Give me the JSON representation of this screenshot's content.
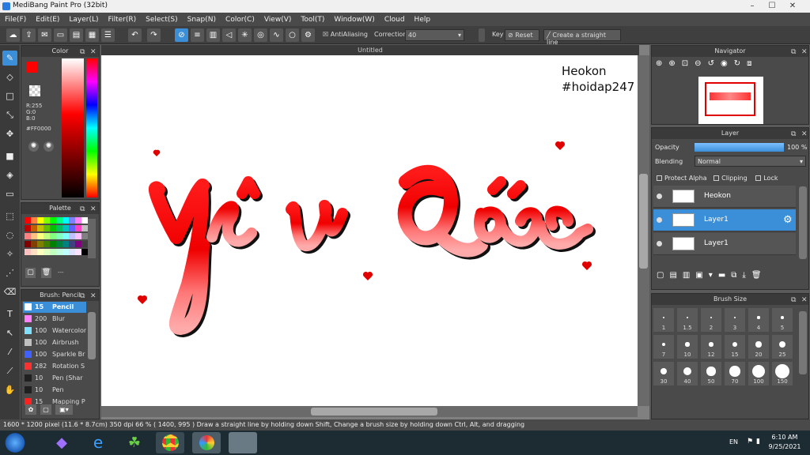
{
  "window": {
    "title": "MediBang Paint Pro (32bit)"
  },
  "menu": [
    "File(F)",
    "Edit(E)",
    "Layer(L)",
    "Filter(R)",
    "Select(S)",
    "Snap(N)",
    "Color(C)",
    "View(V)",
    "Tool(T)",
    "Window(W)",
    "Cloud",
    "Help"
  ],
  "toolbar": {
    "antialias_label": "AntiAliasing",
    "correction_label": "Correction",
    "correction_value": "40",
    "key_label": "Key",
    "reset_label": "Reset",
    "straight_line_label": "Create a straight line"
  },
  "color_panel": {
    "title": "Color",
    "r": "R:255",
    "g": "G:0",
    "b": "B:0",
    "hex": "#FF0000",
    "primary": "#ff0000",
    "secondary": "#ff8c00"
  },
  "palette_panel": {
    "title": "Palette",
    "colors": [
      "#ff0000",
      "#ff8040",
      "#ffff00",
      "#80ff00",
      "#00ff00",
      "#00ff80",
      "#00ffff",
      "#8080ff",
      "#ff80ff",
      "#ffffff",
      "#c00000",
      "#c06000",
      "#c0c000",
      "#60c000",
      "#00c000",
      "#00c060",
      "#00c0c0",
      "#6060ff",
      "#ff40c0",
      "#c0c0c0",
      "#ff8080",
      "#ffc080",
      "#ffff80",
      "#c0ff80",
      "#80ff80",
      "#80ffc0",
      "#80ffff",
      "#c0c0ff",
      "#ffc0ff",
      "#808080",
      "#800000",
      "#804000",
      "#808000",
      "#408000",
      "#008000",
      "#008040",
      "#008080",
      "#404080",
      "#800080",
      "#404040",
      "#ffc0c0",
      "#ffe0c0",
      "#ffffc0",
      "#e0ffc0",
      "#c0ffc0",
      "#c0ffe0",
      "#c0ffff",
      "#e0e0ff",
      "#ffe0ff",
      "#000000"
    ],
    "extra": "---"
  },
  "brush_panel": {
    "title": "Brush: Pencil",
    "items": [
      {
        "size": "15",
        "name": "Pencil",
        "color": "#ffffff",
        "selected": true
      },
      {
        "size": "200",
        "name": "Blur",
        "color": "#ff80ff",
        "selected": false
      },
      {
        "size": "100",
        "name": "Watercolor",
        "color": "#80e0ff",
        "selected": false
      },
      {
        "size": "100",
        "name": "Airbrush",
        "color": "#c0c0c0",
        "selected": false
      },
      {
        "size": "100",
        "name": "Sparkle Br",
        "color": "#4060ff",
        "selected": false
      },
      {
        "size": "282",
        "name": "Rotation S",
        "color": "#ff3030",
        "selected": false
      },
      {
        "size": "10",
        "name": "Pen (Shar",
        "color": "#202020",
        "selected": false
      },
      {
        "size": "10",
        "name": "Pen",
        "color": "#202020",
        "selected": false
      },
      {
        "size": "15",
        "name": "Mapping P",
        "color": "#ff2020",
        "selected": false
      }
    ]
  },
  "canvas": {
    "title": "Untitled",
    "watermark_line1": "Heokon",
    "watermark_line2": "#hoidap247"
  },
  "navigator": {
    "title": "Navigator"
  },
  "layer_panel": {
    "title": "Layer",
    "opacity_label": "Opacity",
    "opacity_value": "100 %",
    "opacity_fraction": 1.0,
    "blending_label": "Blending",
    "blending_value": "Normal",
    "protect_alpha": "Protect Alpha",
    "clipping": "Clipping",
    "lock": "Lock",
    "layers": [
      {
        "name": "Heokon",
        "selected": false
      },
      {
        "name": "Layer1",
        "selected": true
      },
      {
        "name": "Layer1",
        "selected": false
      }
    ]
  },
  "brush_size_panel": {
    "title": "Brush Size",
    "sizes": [
      "1",
      "1.5",
      "2",
      "3",
      "4",
      "5",
      "7",
      "10",
      "12",
      "15",
      "20",
      "25",
      "30",
      "40",
      "50",
      "70",
      "100",
      "150"
    ]
  },
  "status": {
    "text": "1600 * 1200 pixel   (11.6 * 8.7cm)   350 dpi   66 %   ( 1400, 995 )   Draw a straight line by holding down Shift, Change a brush size by holding down Ctrl, Alt, and dragging"
  },
  "taskbar": {
    "lang": "EN",
    "time": "6:10 AM",
    "date": "9/25/2021"
  }
}
